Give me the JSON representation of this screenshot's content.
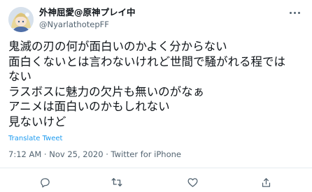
{
  "user": {
    "display_name": "外神屈愛@原神プレイ中",
    "handle": "@NyarlathotepFF"
  },
  "tweet": {
    "lines": [
      "鬼滅の刃の何が面白いのかよく分からない",
      "面白くないとは言わないけれど世間で騒がれる程では",
      "ない",
      "ラスボスに魅力の欠片も無いのがなぁ",
      "アニメは面白いのかもしれない",
      "見ないけど"
    ],
    "translate_label": "Translate Tweet",
    "meta": "7:12 AM · Nov 25, 2020 · Twitter for iPhone"
  },
  "icons": {
    "avatar": "avatar",
    "more": "more-icon",
    "reply": "reply-icon",
    "retweet": "retweet-icon",
    "like": "like-icon",
    "share": "share-icon"
  },
  "colors": {
    "link": "#1d9bf0",
    "secondary_text": "#536471",
    "icon": "#536471"
  }
}
